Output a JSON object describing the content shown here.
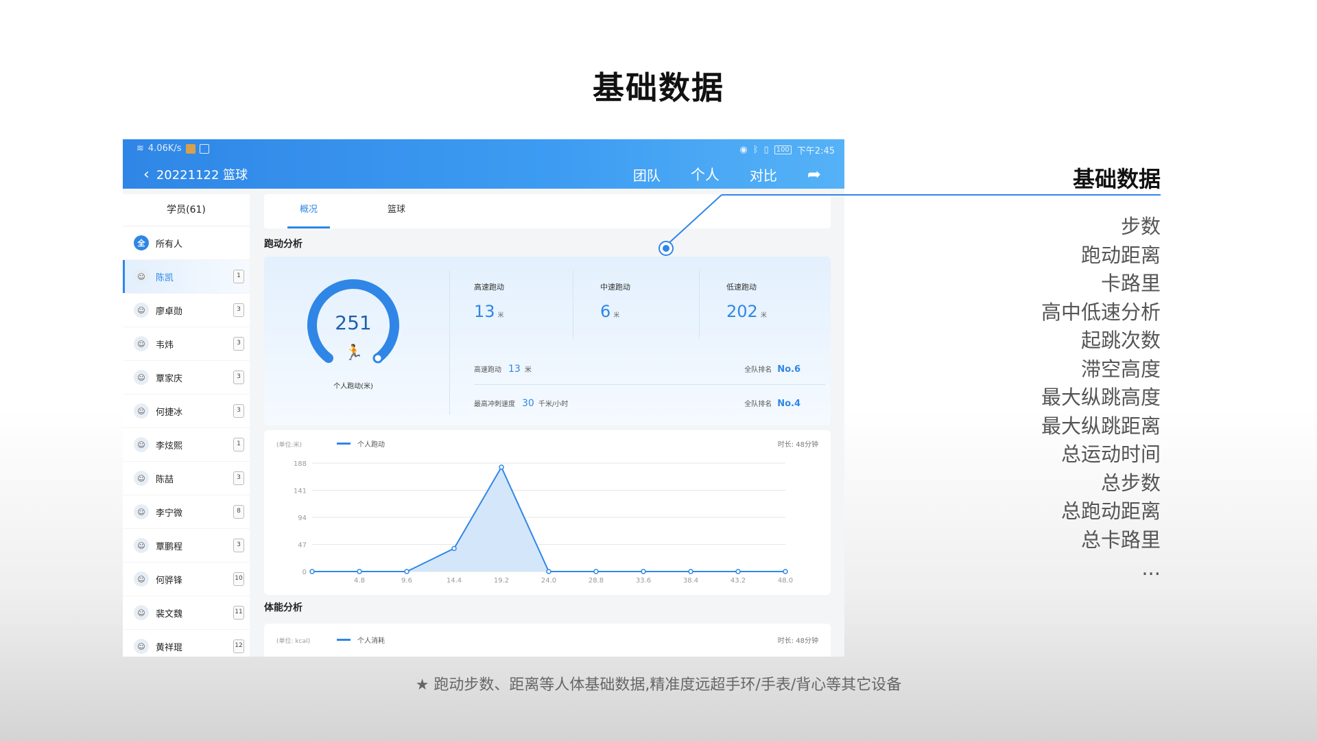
{
  "page_title": "基础数据",
  "status_bar": {
    "speed": "4.06K/s",
    "time": "下午2:45",
    "battery": "100"
  },
  "header": {
    "title": "20221122 篮球",
    "tabs": [
      "团队",
      "个人",
      "对比"
    ]
  },
  "sidebar": {
    "heading": "学员(61)",
    "all_label": "所有人",
    "all_avatar": "全",
    "players": [
      {
        "name": "陈凯",
        "number": "1",
        "active": true
      },
      {
        "name": "廖卓勋",
        "number": "3"
      },
      {
        "name": "韦炜",
        "number": "3"
      },
      {
        "name": "覃家庆",
        "number": "3"
      },
      {
        "name": "何捷冰",
        "number": "3"
      },
      {
        "name": "李炫熙",
        "number": "1"
      },
      {
        "name": "陈喆",
        "number": "3"
      },
      {
        "name": "李宁微",
        "number": "8"
      },
      {
        "name": "覃鹏程",
        "number": "3"
      },
      {
        "name": "何骅锋",
        "number": "10"
      },
      {
        "name": "裴文魏",
        "number": "11"
      },
      {
        "name": "黄祥琨",
        "number": "12"
      }
    ]
  },
  "main_tabs": [
    "概况",
    "篮球"
  ],
  "running": {
    "section_title": "跑动分析",
    "total": "251",
    "total_label": "个人跑动(米)",
    "stats": [
      {
        "label": "高速跑动",
        "value": "13",
        "unit": "米"
      },
      {
        "label": "中速跑动",
        "value": "6",
        "unit": "米"
      },
      {
        "label": "低速跑动",
        "value": "202",
        "unit": "米"
      }
    ],
    "row1": {
      "label": "高速跑动",
      "value": "13",
      "unit": "米",
      "rank_label": "全队排名",
      "rank": "No.6"
    },
    "row2": {
      "label": "最高冲刺速度",
      "value": "30",
      "unit": "千米/小时",
      "rank_label": "全队排名",
      "rank": "No.4"
    }
  },
  "chart_data": {
    "type": "area",
    "unit_label": "(单位:米)",
    "legend": "个人跑动",
    "duration": "时长: 48分钟",
    "x": [
      0,
      4.8,
      9.6,
      14.4,
      19.2,
      24.0,
      28.8,
      33.6,
      38.4,
      43.2,
      48.0
    ],
    "x_ticks": [
      "0",
      "4.8",
      "9.6",
      "14.4",
      "19.2",
      "24.0",
      "28.8",
      "33.6",
      "38.4",
      "43.2",
      "48.0"
    ],
    "y_ticks": [
      "0",
      "47",
      "94",
      "141",
      "188"
    ],
    "ylim": [
      0,
      188
    ],
    "series": [
      {
        "name": "个人跑动",
        "values": [
          0,
          0,
          0,
          40,
          181,
          0,
          0,
          0,
          0,
          0,
          0
        ]
      }
    ]
  },
  "fitness": {
    "section_title": "体能分析",
    "unit_label": "(单位: kcal)",
    "legend": "个人消耗",
    "duration": "时长: 48分钟"
  },
  "right_panel": {
    "title": "基础数据",
    "items": [
      "步数",
      "跑动距离",
      "卡路里",
      "高中低速分析",
      "起跳次数",
      "滞空高度",
      "最大纵跳高度",
      "最大纵跳距离",
      "总运动时间",
      "总步数",
      "总跑动距离",
      "总卡路里",
      "..."
    ]
  },
  "footnote": "★ 跑动步数、距离等人体基础数据,精准度远超手环/手表/背心等其它设备",
  "colors": {
    "accent": "#2f86e6",
    "header": "#3d9cf2"
  }
}
